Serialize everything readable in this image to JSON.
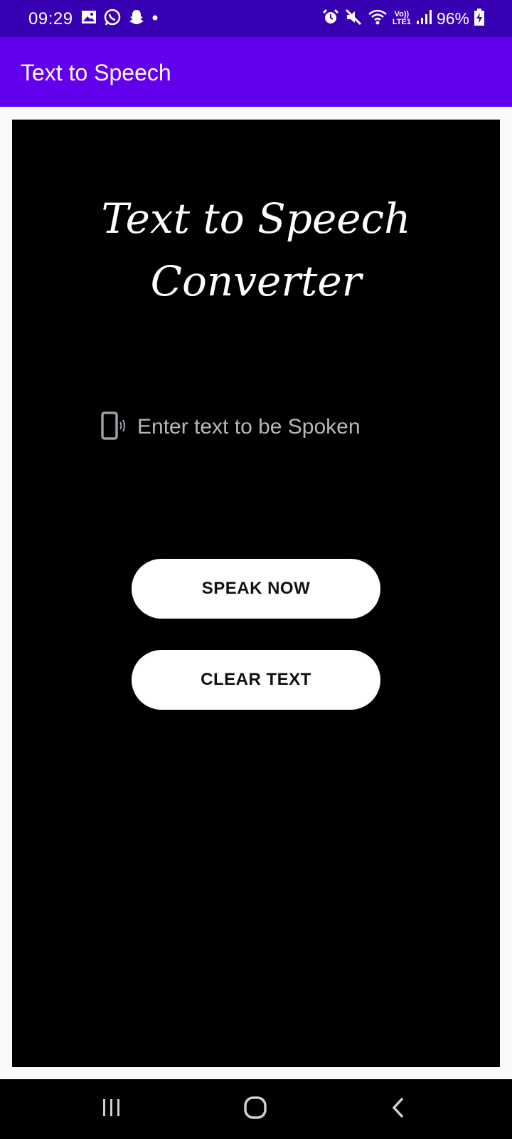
{
  "status_bar": {
    "time": "09:29",
    "battery": "96%",
    "network": "LTE1",
    "volte": "Vo))",
    "left_icons": [
      "gallery-icon",
      "whatsapp-icon",
      "snapchat-icon",
      "dot-icon"
    ],
    "right_icons": [
      "alarm-icon",
      "mute-icon",
      "wifi-icon",
      "volte-icon",
      "signal-icon",
      "battery-icon"
    ]
  },
  "app_bar": {
    "title": "Text to Speech"
  },
  "main": {
    "heading_line1": "Text to Speech",
    "heading_line2": "Converter",
    "input": {
      "placeholder": "Enter text to be Spoken",
      "value": "",
      "icon": "phone-speaker-icon"
    },
    "buttons": {
      "speak": "SPEAK NOW",
      "clear": "CLEAR TEXT"
    }
  },
  "nav_bar": {
    "icons": [
      "recents-icon",
      "home-icon",
      "back-icon"
    ]
  },
  "colors": {
    "status_bar": "#3700b3",
    "app_bar": "#6200ee",
    "panel": "#000000",
    "button": "#ffffff"
  }
}
